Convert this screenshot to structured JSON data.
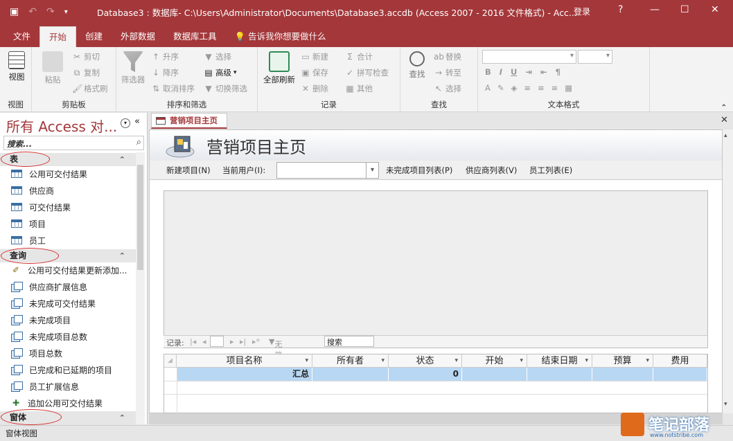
{
  "window": {
    "title": "Database3 : 数据库- C:\\Users\\Administrator\\Documents\\Database3.accdb (Access 2007 - 2016 文件格式)  -  Acc...",
    "sign_in": "登录",
    "help": "?",
    "minimize": "—",
    "maximize": "☐",
    "close": "✕"
  },
  "tabs": [
    "文件",
    "开始",
    "创建",
    "外部数据",
    "数据库工具"
  ],
  "tell_me": "告诉我你想要做什么",
  "ribbon": {
    "view": {
      "label": "视图",
      "group": "视图"
    },
    "clipboard": {
      "paste": "粘贴",
      "cut": "剪切",
      "copy": "复制",
      "format_painter": "格式刷",
      "group": "剪贴板"
    },
    "sort": {
      "filter": "筛选器",
      "asc": "升序",
      "desc": "降序",
      "remove_sort": "取消排序",
      "selection": "选择",
      "advanced": "高级",
      "toggle_filter": "切换筛选",
      "group": "排序和筛选"
    },
    "records": {
      "refresh": "全部刷新",
      "new": "新建",
      "save": "保存",
      "delete": "删除",
      "totals": "合计",
      "spelling": "拼写检查",
      "more": "其他",
      "group": "记录"
    },
    "find": {
      "find": "查找",
      "replace": "替换",
      "goto": "转至",
      "select": "选择",
      "group": "查找"
    },
    "text": {
      "group": "文本格式"
    }
  },
  "nav": {
    "title": "所有 Access 对...",
    "search_placeholder": "搜索...",
    "sections": [
      {
        "name": "表",
        "items": [
          "公用可交付结果",
          "供应商",
          "可交付结果",
          "项目",
          "员工"
        ]
      },
      {
        "name": "查询",
        "items": [
          "公用可交付结果更新添加...",
          "供应商扩展信息",
          "未完成可交付结果",
          "未完成项目",
          "未完成项目总数",
          "项目总数",
          "已完成和已延期的项目",
          "员工扩展信息",
          "追加公用可交付结果"
        ]
      },
      {
        "name": "窗体",
        "items": []
      }
    ]
  },
  "document": {
    "tab": "营销项目主页",
    "close": "✕",
    "form_title": "营销项目主页",
    "links": {
      "new_project": "新建项目(N)",
      "current_user": "当前用户(I):",
      "open_list": "未完成项目列表(P)",
      "vendors": "供应商列表(V)",
      "employees": "员工列表(E)"
    },
    "record_nav": {
      "label": "记录:",
      "no_filter": "无筛选器",
      "search": "搜索"
    },
    "grid": {
      "columns": [
        "项目名称",
        "所有者",
        "状态",
        "开始",
        "结束日期",
        "预算",
        "费用"
      ],
      "total_label": "汇总",
      "total_status": "0"
    }
  },
  "status_bar": "窗体视图",
  "watermark": {
    "brand": "笔记部落",
    "sub": "www.notstribe.com"
  },
  "colors": {
    "accent": "#a4373a",
    "selection": "#b8d7f3"
  }
}
